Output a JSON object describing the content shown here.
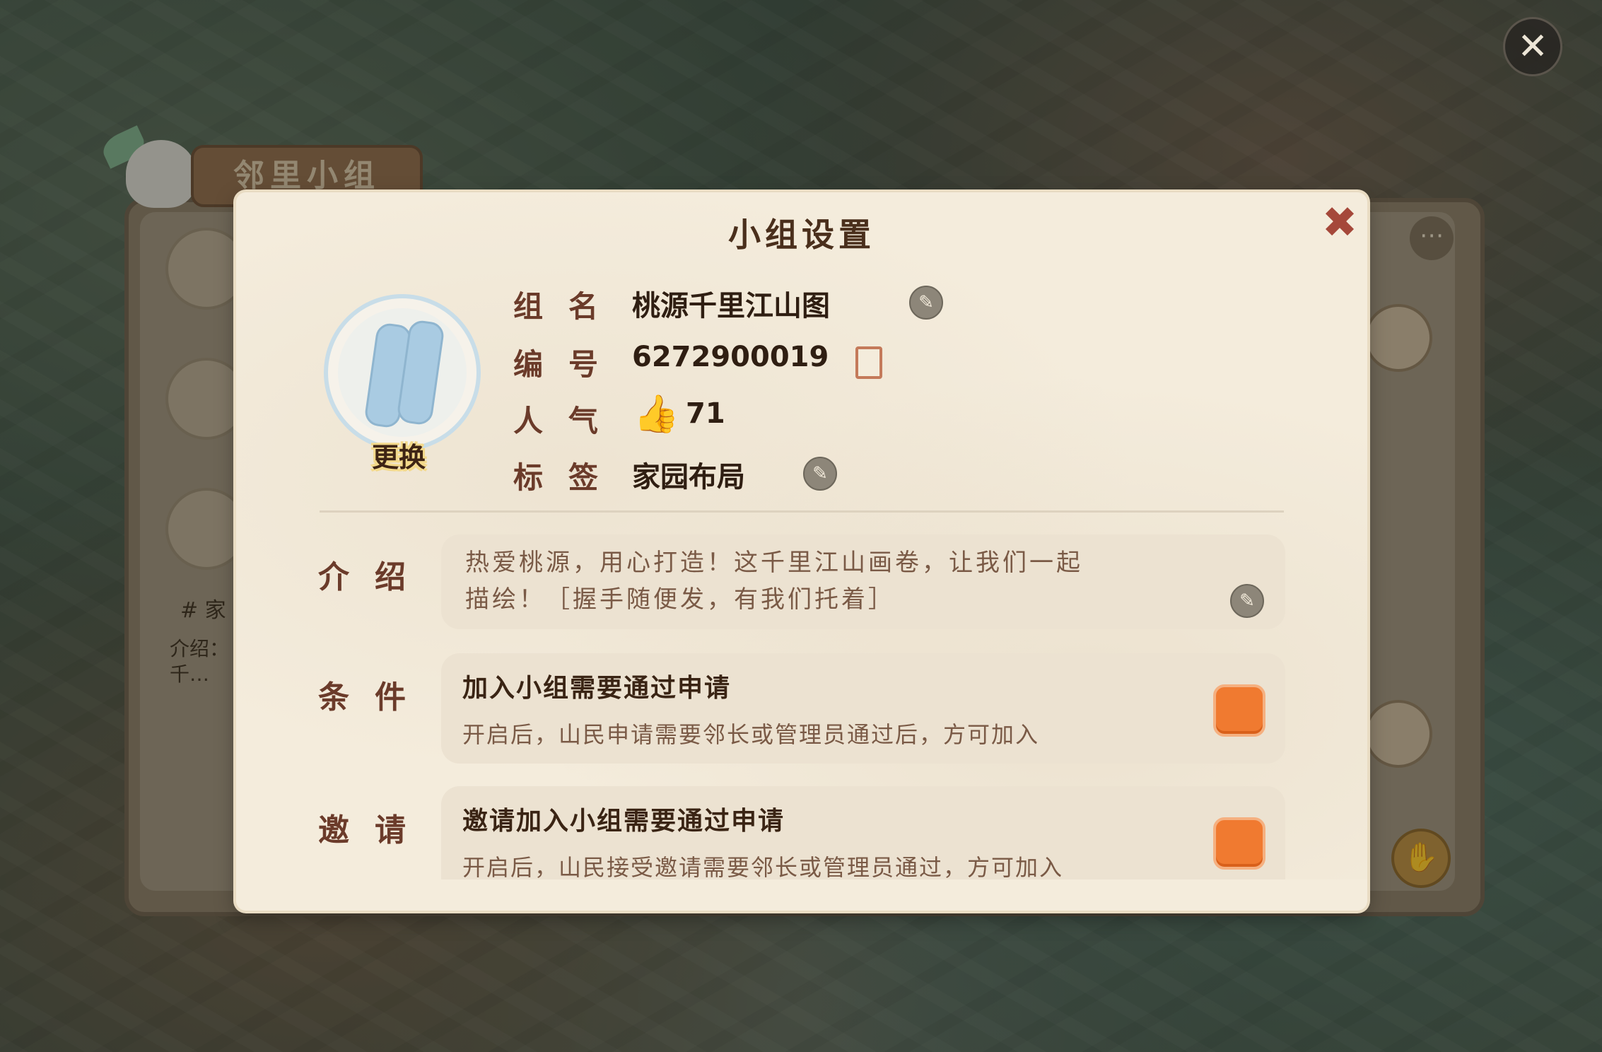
{
  "background_panel": {
    "title": "邻里小组",
    "tag_text": "# 家",
    "intro_text": "介绍：",
    "intro_text_2": "千…"
  },
  "dialog": {
    "title": "小组设置",
    "avatar_change_label": "更换",
    "fields": {
      "name_label": "组名",
      "name_value": "桃源千里江山图",
      "id_label": "编号",
      "id_value": "6272900019",
      "popularity_label": "人气",
      "popularity_value": "71",
      "tag_label": "标签",
      "tag_value": "家园布局"
    },
    "intro": {
      "label": "介绍",
      "line1": "热爱桃源，用心打造！这千里江山画卷，让我们一起",
      "line2": "描绘！［握手随便发，有我们托着］"
    },
    "condition": {
      "label": "条件",
      "title": "加入小组需要通过申请",
      "desc": "开启后，山民申请需要邻长或管理员通过后，方可加入"
    },
    "invite": {
      "label": "邀请",
      "title": "邀请加入小组需要通过申请",
      "desc": "开启后，山民接受邀请需要邻长或管理员通过，方可加入"
    }
  },
  "icons": {
    "close": "close-icon",
    "edit": "pencil-icon",
    "copy": "copy-icon",
    "thumb": "thumbs-up-icon"
  },
  "colors": {
    "accent_orange": "#f07a30",
    "label_brown": "#6b3b2a",
    "dialog_bg": "#f4ecdc"
  }
}
